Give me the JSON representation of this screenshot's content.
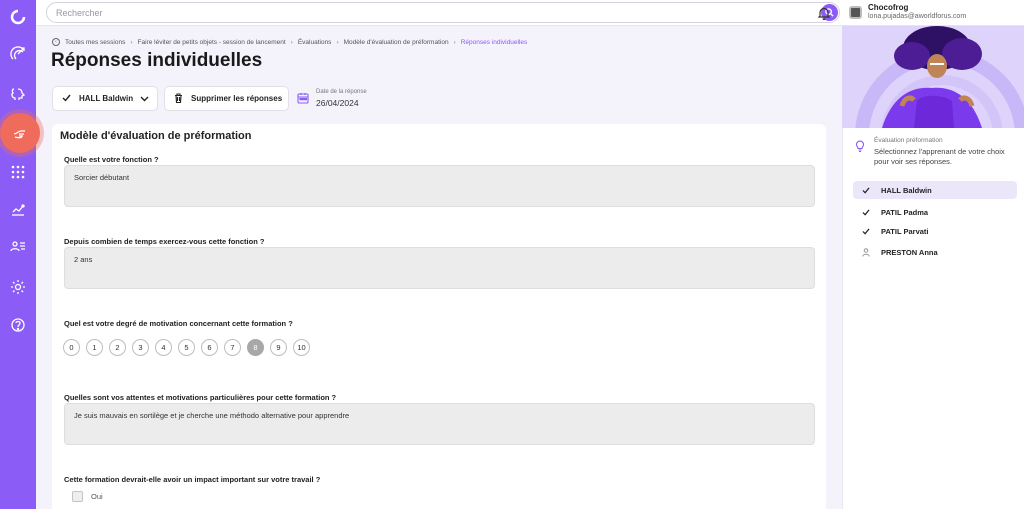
{
  "topbar": {
    "search_placeholder": "Rechercher",
    "user_name": "Chocofrog",
    "user_email": "lona.pujadas@aworldforus.com"
  },
  "breadcrumb": [
    "Toutes mes sessions",
    "Faire léviter de petits objets - session de lancement",
    "Évaluations",
    "Modèle d'évaluation de préformation",
    "Réponses individuelles"
  ],
  "page": {
    "title": "Réponses individuelles"
  },
  "toolbar": {
    "selected_learner": "HALL Baldwin",
    "delete_label": "Supprimer les réponses",
    "date_label": "Date de la réponse",
    "date_value": "26/04/2024"
  },
  "form": {
    "title": "Modèle d'évaluation de préformation",
    "q1": {
      "label": "Quelle est votre fonction ?",
      "answer": "Sorcier débutant"
    },
    "q2": {
      "label": "Depuis combien de temps exercez-vous cette fonction ?",
      "answer": "2 ans"
    },
    "q3": {
      "label": "Quel est votre degré de motivation concernant cette formation ?",
      "options": [
        "0",
        "1",
        "2",
        "3",
        "4",
        "5",
        "6",
        "7",
        "8",
        "9",
        "10"
      ],
      "selected": "8"
    },
    "q4": {
      "label": "Quelles sont vos attentes et motivations particulières pour cette formation ?",
      "answer": "Je suis mauvais en sortilège et je cherche une méthodo alternative pour apprendre"
    },
    "q5": {
      "label": "Cette formation devrait-elle avoir un impact important sur votre travail ?",
      "option": "Oui"
    }
  },
  "right_panel": {
    "hint_title": "Évaluation préformation",
    "hint_text": "Sélectionnez l'apprenant de votre choix pour voir ses réponses.",
    "learners": [
      {
        "name": "HALL Baldwin",
        "status": "answered",
        "active": true
      },
      {
        "name": "PATIL Padma",
        "status": "answered",
        "active": false
      },
      {
        "name": "PATIL Parvati",
        "status": "answered",
        "active": false
      },
      {
        "name": "PRESTON Anna",
        "status": "pending",
        "active": false
      }
    ]
  },
  "colors": {
    "accent": "#8b5cf6",
    "active_nav": "#ef6b5b"
  },
  "icons": [
    "logo-icon",
    "target-arrow-icon",
    "brain-icon",
    "hand-icon",
    "grid-icon",
    "chart-icon",
    "users-list-icon",
    "settings-icon",
    "help-icon",
    "search-icon",
    "bell-icon",
    "check-icon",
    "chevron-down-icon",
    "trash-icon",
    "calendar-icon",
    "lightbulb-icon",
    "person-icon"
  ]
}
